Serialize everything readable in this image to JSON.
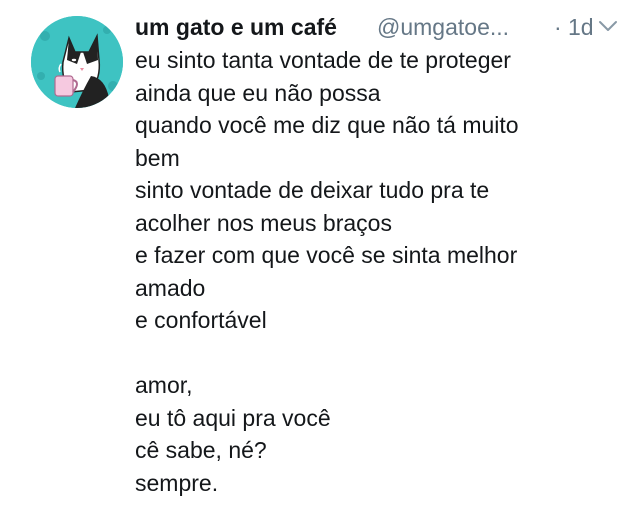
{
  "tweet": {
    "display_name": "um gato e um café",
    "handle": "@umgatoe...",
    "separator": "·",
    "timestamp": "1d",
    "menu_icon": "chevron-down-icon",
    "avatar_icon": "cat-with-coffee-mug-avatar",
    "lines": [
      "eu sinto tanta vontade de te proteger",
      "ainda que eu não possa",
      "quando você me diz que não tá muito",
      "bem",
      "sinto vontade de deixar tudo pra te",
      "acolher nos meus braços",
      "e fazer com que você se sinta melhor",
      "amado",
      "e confortável",
      "",
      "amor,",
      "eu tô aqui pra você",
      "cê sabe, né?",
      "sempre."
    ]
  },
  "colors": {
    "text": "#14171a",
    "muted": "#657786",
    "avatar_bg": "#3ec3c2"
  }
}
